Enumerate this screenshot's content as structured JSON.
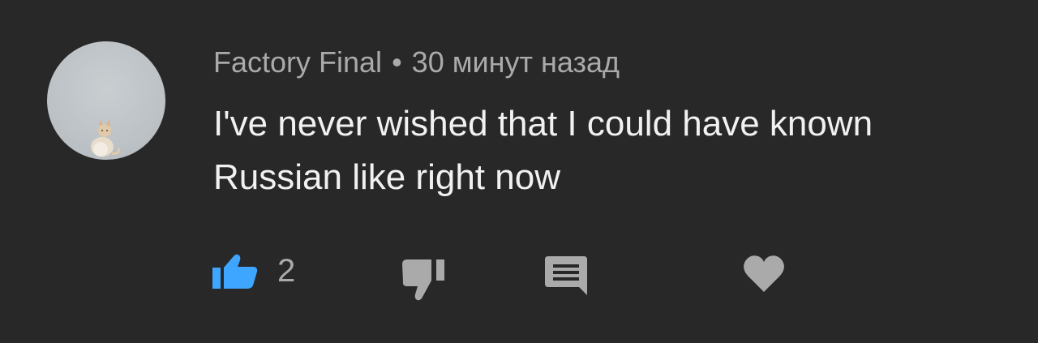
{
  "comment": {
    "author": "Factory Final",
    "separator": "•",
    "time": "30 минут назад",
    "text": "I've never wished that I could have known Russian like right now"
  },
  "actions": {
    "like_count": "2",
    "like_icon": "thumbs-up-icon",
    "dislike_icon": "thumbs-down-icon",
    "reply_icon": "comment-icon",
    "heart_icon": "heart-icon"
  },
  "colors": {
    "background": "#282828",
    "like_active": "#3ea6ff",
    "icon_gray": "#aaaaaa",
    "text": "#f1f1f1"
  }
}
